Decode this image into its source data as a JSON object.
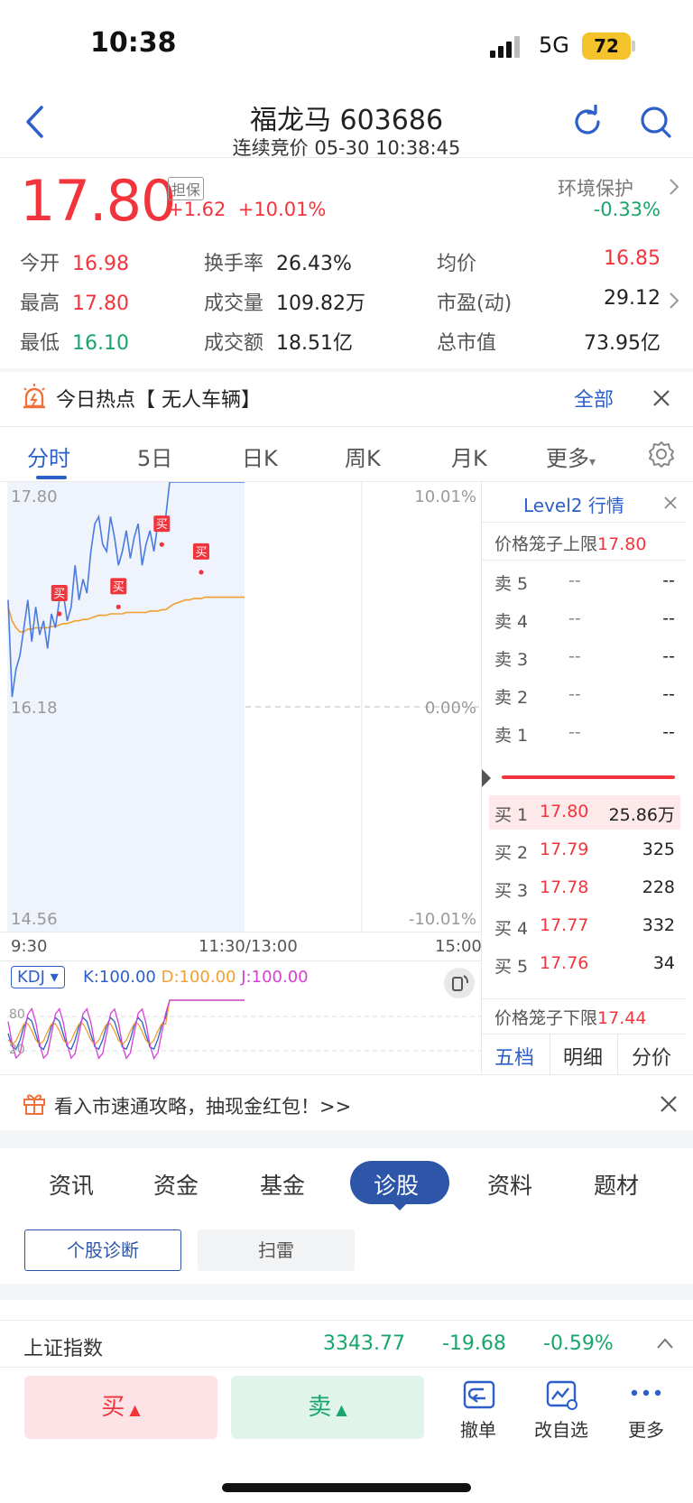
{
  "status": {
    "time": "10:38",
    "network": "5G",
    "battery": "72"
  },
  "header": {
    "title": "福龙马 603686",
    "subtitle": "连续竞价 05-30 10:38:45"
  },
  "quote": {
    "price": "17.80",
    "tag": "担保",
    "change": "+1.62",
    "change_pct": "+10.01%",
    "sector": "环境保护",
    "sector_pct": "-0.33%",
    "open_label": "今开",
    "open": "16.98",
    "high_label": "最高",
    "high": "17.80",
    "low_label": "最低",
    "low": "16.10",
    "turnover_label": "换手率",
    "turnover": "26.43%",
    "volume_label": "成交量",
    "volume": "109.82万",
    "amount_label": "成交额",
    "amount": "18.51亿",
    "avg_label": "均价",
    "avg": "16.85",
    "pe_label": "市盈(动)",
    "pe": "29.12",
    "mktcap_label": "总市值",
    "mktcap": "73.95亿"
  },
  "hotspot": {
    "text": "今日热点【 无人车辆】",
    "all": "全部"
  },
  "chart_tabs": [
    "分时",
    "5日",
    "日K",
    "周K",
    "月K",
    "更多"
  ],
  "chart_data": {
    "type": "line",
    "title": "",
    "ylim": [
      14.56,
      17.8
    ],
    "y_ticks_left": [
      "17.80",
      "16.18",
      "14.56"
    ],
    "y_ticks_right": [
      "10.01%",
      "0.00%",
      "-10.01%"
    ],
    "x_ticks": [
      "9:30",
      "11:30/13:00",
      "15:00"
    ],
    "price_line_x": [
      0,
      2,
      4,
      6,
      8,
      10,
      12,
      14,
      16,
      18,
      20,
      22,
      24,
      26,
      28,
      30,
      32,
      34,
      36,
      38,
      40,
      42,
      44,
      46,
      48,
      50,
      52,
      54,
      56,
      58,
      60,
      62,
      64,
      66,
      68,
      70,
      72,
      74,
      76,
      78,
      80,
      82,
      84,
      86,
      88,
      90,
      92,
      94,
      96,
      98,
      100,
      102,
      104,
      106,
      108,
      110,
      112,
      114,
      116,
      118,
      120
    ],
    "price_line_y": [
      16.95,
      16.25,
      16.45,
      16.55,
      16.75,
      16.95,
      16.65,
      16.9,
      16.7,
      16.8,
      16.6,
      16.85,
      16.75,
      16.95,
      17.0,
      16.8,
      16.9,
      17.2,
      16.95,
      17.1,
      17.0,
      17.3,
      17.5,
      17.55,
      17.35,
      17.3,
      17.55,
      17.4,
      17.2,
      17.3,
      17.45,
      17.25,
      17.4,
      17.5,
      17.2,
      17.35,
      17.45,
      17.3,
      17.5,
      17.45,
      17.55,
      17.8,
      17.8,
      17.8,
      17.8,
      17.8,
      17.8,
      17.8,
      17.8,
      17.8,
      17.8,
      17.8,
      17.8,
      17.8,
      17.8,
      17.8,
      17.8,
      17.8,
      17.8,
      17.8,
      17.8
    ],
    "avg_line_y": [
      16.9,
      16.8,
      16.75,
      16.72,
      16.72,
      16.74,
      16.74,
      16.75,
      16.75,
      16.75,
      16.75,
      16.76,
      16.76,
      16.77,
      16.78,
      16.78,
      16.79,
      16.8,
      16.8,
      16.81,
      16.81,
      16.82,
      16.83,
      16.84,
      16.84,
      16.84,
      16.85,
      16.85,
      16.85,
      16.85,
      16.86,
      16.86,
      16.86,
      16.86,
      16.86,
      16.86,
      16.87,
      16.87,
      16.87,
      16.88,
      16.88,
      16.9,
      16.92,
      16.93,
      16.94,
      16.95,
      16.95,
      16.96,
      16.96,
      16.96,
      16.97,
      16.97,
      16.97,
      16.97,
      16.97,
      16.97,
      16.97,
      16.97,
      16.97,
      16.97,
      16.97
    ],
    "buy_marks": [
      {
        "x": 26,
        "y": 16.85
      },
      {
        "x": 56,
        "y": 16.9
      },
      {
        "x": 78,
        "y": 17.35
      },
      {
        "x": 98,
        "y": 17.15
      }
    ],
    "buy_label": "买",
    "kdj": {
      "label": "KDJ",
      "k": "K:100.00",
      "d": "D:100.00",
      "j": "J:100.00",
      "ticks": [
        "80",
        "20"
      ]
    }
  },
  "order_book": {
    "title": "Level2 行情",
    "upper_limit_label": "价格笼子上限",
    "upper_limit": "17.80",
    "lower_limit_label": "价格笼子下限",
    "lower_limit": "17.44",
    "asks": [
      {
        "label": "卖 5",
        "price": "--",
        "vol": "--"
      },
      {
        "label": "卖 4",
        "price": "--",
        "vol": "--"
      },
      {
        "label": "卖 3",
        "price": "--",
        "vol": "--"
      },
      {
        "label": "卖 2",
        "price": "--",
        "vol": "--"
      },
      {
        "label": "卖 1",
        "price": "--",
        "vol": "--"
      }
    ],
    "bids": [
      {
        "label": "买 1",
        "price": "17.80",
        "vol": "25.86万"
      },
      {
        "label": "买 2",
        "price": "17.79",
        "vol": "325"
      },
      {
        "label": "买 3",
        "price": "17.78",
        "vol": "228"
      },
      {
        "label": "买 4",
        "price": "17.77",
        "vol": "332"
      },
      {
        "label": "买 5",
        "price": "17.76",
        "vol": "34"
      }
    ],
    "tabs": [
      "五档",
      "明细",
      "分价"
    ]
  },
  "promo": {
    "text": "看入市速通攻略，抽现金红包！>>"
  },
  "feature_tabs": [
    "资讯",
    "资金",
    "基金",
    "诊股",
    "资料",
    "题材"
  ],
  "sub_tabs": [
    "个股诊断",
    "扫雷"
  ],
  "index_bar": {
    "name": "上证指数",
    "value": "3343.77",
    "change": "-19.68",
    "pct": "-0.59%"
  },
  "actions": {
    "buy": "买",
    "sell": "卖",
    "cancel": "撤单",
    "watch": "改自选",
    "more": "更多"
  },
  "colors": {
    "up": "#f2353d",
    "down": "#18a66c",
    "accent": "#2d5fc8",
    "price_line": "#4a7be0",
    "avg_line": "#f0a030"
  }
}
